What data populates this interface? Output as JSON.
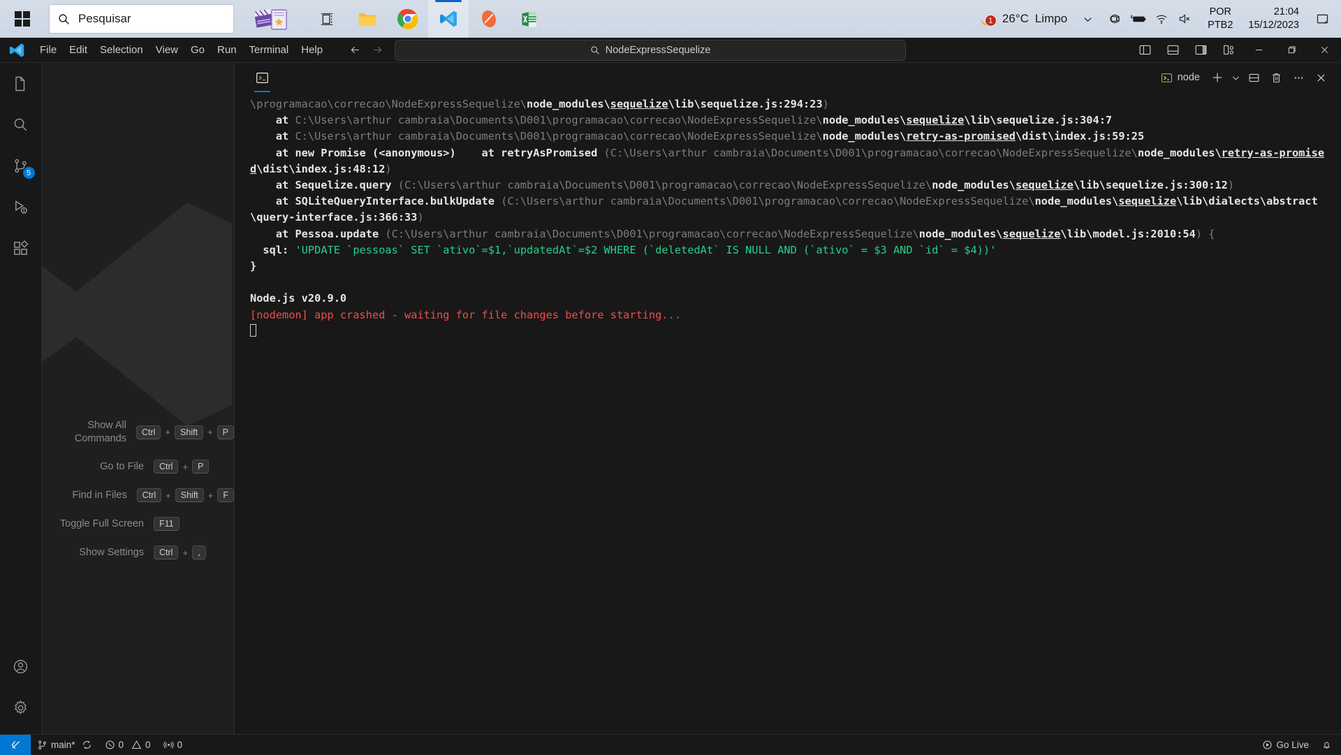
{
  "taskbar": {
    "start_icon": "windows-logo-icon",
    "search": {
      "placeholder": "Pesquisar",
      "icon": "search-icon"
    },
    "apps": [
      {
        "name": "task-view",
        "icon": "task-view-icon",
        "active": false
      },
      {
        "name": "file-explorer",
        "icon": "folder-icon",
        "active": false
      },
      {
        "name": "google-chrome",
        "icon": "chrome-icon",
        "active": false
      },
      {
        "name": "visual-studio-code",
        "icon": "vscode-icon",
        "active": true
      },
      {
        "name": "postman",
        "icon": "postman-icon",
        "active": false
      },
      {
        "name": "excel",
        "icon": "excel-icon",
        "active": false
      }
    ],
    "weather": {
      "icon": "moon-icon",
      "badge": "1",
      "temperature": "26°C",
      "condition": "Limpo"
    },
    "tray": {
      "chevron": "chevron-up-icon",
      "icons": [
        "camera-icon",
        "battery-charging-icon",
        "wifi-icon",
        "speaker-muted-icon"
      ]
    },
    "language": {
      "line1": "POR",
      "line2": "PTB2"
    },
    "clock": {
      "time": "21:04",
      "date": "15/12/2023"
    },
    "notifications_icon": "notification-bell-icon"
  },
  "vscode": {
    "menu": [
      "File",
      "Edit",
      "Selection",
      "View",
      "Go",
      "Run",
      "Terminal",
      "Help"
    ],
    "nav": {
      "back": "arrow-left-icon",
      "forward": "arrow-right-icon"
    },
    "command_center": {
      "icon": "search-icon",
      "text": "NodeExpressSequelize"
    },
    "layout_actions": [
      "toggle-primary-sidebar-icon",
      "toggle-panel-icon",
      "toggle-secondary-sidebar-icon",
      "customize-layout-icon"
    ],
    "window_controls": {
      "minimize": "minimize-icon",
      "maximize": "maximize-icon",
      "close": "close-icon"
    },
    "activitybar": [
      {
        "name": "explorer",
        "icon": "files-icon",
        "badge": ""
      },
      {
        "name": "search",
        "icon": "search-icon",
        "badge": ""
      },
      {
        "name": "source-control",
        "icon": "source-control-icon",
        "badge": "5"
      },
      {
        "name": "run-and-debug",
        "icon": "debug-icon",
        "badge": ""
      },
      {
        "name": "extensions",
        "icon": "extensions-icon",
        "badge": ""
      }
    ],
    "activitybar_bottom": [
      {
        "name": "accounts",
        "icon": "account-icon"
      },
      {
        "name": "manage",
        "icon": "gear-icon"
      }
    ],
    "shortcuts": [
      {
        "label": "Show All Commands",
        "keys": [
          "Ctrl",
          "Shift",
          "P"
        ]
      },
      {
        "label": "Go to File",
        "keys": [
          "Ctrl",
          "P"
        ]
      },
      {
        "label": "Find in Files",
        "keys": [
          "Ctrl",
          "Shift",
          "F"
        ]
      },
      {
        "label": "Toggle Full Screen",
        "keys": [
          "F11"
        ]
      },
      {
        "label": "Show Settings",
        "keys": [
          "Ctrl",
          ","
        ]
      }
    ],
    "panel": {
      "tab_icon": "terminal-icon",
      "terminal_tab": {
        "icon": "terminal-icon",
        "label": "node"
      },
      "actions": [
        "add-terminal-icon",
        "chevron-down-icon",
        "split-terminal-icon",
        "kill-terminal-icon",
        "more-actions-icon",
        "close-panel-icon"
      ]
    },
    "statusbar": {
      "remote_icon": "remote-window-icon",
      "branch": {
        "icon": "source-control-icon",
        "label": "main*",
        "sync_icon": "sync-icon"
      },
      "problems": {
        "errors_icon": "error-icon",
        "errors": "0",
        "warnings_icon": "warning-icon",
        "warnings": "0"
      },
      "ports": {
        "icon": "radio-tower-icon",
        "count": "0"
      },
      "go_live": {
        "icon": "broadcast-icon",
        "label": "Go Live"
      },
      "bell_icon": "notification-bell-icon"
    }
  },
  "terminal_output": {
    "lines": [
      {
        "segments": [
          {
            "t": "\\programacao\\correcao\\NodeExpressSequelize\\",
            "c": "dim"
          },
          {
            "t": "node_modules\\",
            "c": "w"
          },
          {
            "t": "sequelize",
            "c": "link"
          },
          {
            "t": "\\lib\\sequelize.js:294:23",
            "c": "w"
          },
          {
            "t": ")",
            "c": "dim"
          }
        ]
      },
      {
        "segments": [
          {
            "t": "    at ",
            "c": "w"
          },
          {
            "t": "C:\\Users\\arthur cambraia\\Documents\\D001\\programacao\\correcao\\NodeExpressSequelize\\",
            "c": "dim"
          },
          {
            "t": "node_modules\\",
            "c": "w"
          },
          {
            "t": "sequelize",
            "c": "link"
          },
          {
            "t": "\\lib\\sequelize.js:304:7",
            "c": "w"
          }
        ]
      },
      {
        "segments": [
          {
            "t": "    at ",
            "c": "w"
          },
          {
            "t": "C:\\Users\\arthur cambraia\\Documents\\D001\\programacao\\correcao\\NodeExpressSequelize\\",
            "c": "dim"
          },
          {
            "t": "node_modules\\",
            "c": "w"
          },
          {
            "t": "retry-as-promised",
            "c": "link"
          },
          {
            "t": "\\dist\\index.js:59:25",
            "c": "w"
          }
        ]
      },
      {
        "segments": [
          {
            "t": "    at new Promise (<anonymous>)",
            "c": "w"
          },
          {
            "t": "    at retryAsPromised ",
            "c": "w"
          },
          {
            "t": "(C:\\Users\\arthur cambraia\\Documents\\D001\\programacao\\correcao\\NodeExpressSequelize\\",
            "c": "dim"
          },
          {
            "t": "node_modules\\",
            "c": "w"
          },
          {
            "t": "retry-as-promised",
            "c": "link"
          },
          {
            "t": "\\dist\\index.js:48:12",
            "c": "w"
          },
          {
            "t": ")",
            "c": "dim"
          }
        ]
      },
      {
        "segments": [
          {
            "t": "    at Sequelize.query ",
            "c": "w"
          },
          {
            "t": "(C:\\Users\\arthur cambraia\\Documents\\D001\\programacao\\correcao\\NodeExpressSequelize\\",
            "c": "dim"
          },
          {
            "t": "node_modules\\",
            "c": "w"
          },
          {
            "t": "sequelize",
            "c": "link"
          },
          {
            "t": "\\lib\\sequelize.js:300:12",
            "c": "w"
          },
          {
            "t": ")",
            "c": "dim"
          }
        ]
      },
      {
        "segments": [
          {
            "t": "    at SQLiteQueryInterface.bulkUpdate ",
            "c": "w"
          },
          {
            "t": "(C:\\Users\\arthur cambraia\\Documents\\D001\\programacao\\correcao\\NodeExpressSequelize\\",
            "c": "dim"
          },
          {
            "t": "node_modules\\",
            "c": "w"
          },
          {
            "t": "sequelize",
            "c": "link"
          },
          {
            "t": "\\lib\\dialects\\abstract\\query-interface.js:366:33",
            "c": "w"
          },
          {
            "t": ")",
            "c": "dim"
          }
        ]
      },
      {
        "segments": [
          {
            "t": "    at Pessoa.update ",
            "c": "w"
          },
          {
            "t": "(C:\\Users\\arthur cambraia\\Documents\\D001\\programacao\\correcao\\NodeExpressSequelize\\",
            "c": "dim"
          },
          {
            "t": "node_modules\\",
            "c": "w"
          },
          {
            "t": "sequelize",
            "c": "link"
          },
          {
            "t": "\\lib\\model.js:2010:54",
            "c": "w"
          },
          {
            "t": ") {",
            "c": "dim"
          }
        ]
      },
      {
        "segments": [
          {
            "t": "  sql: ",
            "c": "w"
          },
          {
            "t": "'UPDATE `pessoas` SET `ativo`=$1,`updatedAt`=$2 WHERE (`deletedAt` IS NULL AND (`ativo` = $3 AND `id` = $4))'",
            "c": "green"
          }
        ]
      },
      {
        "segments": [
          {
            "t": "}",
            "c": "w"
          }
        ]
      },
      {
        "segments": [
          {
            "t": "",
            "c": "w"
          }
        ]
      },
      {
        "segments": [
          {
            "t": "Node.js v20.9.0",
            "c": "w"
          }
        ]
      },
      {
        "segments": [
          {
            "t": "[nodemon] app crashed - waiting for file changes before starting...",
            "c": "red"
          }
        ]
      }
    ]
  }
}
